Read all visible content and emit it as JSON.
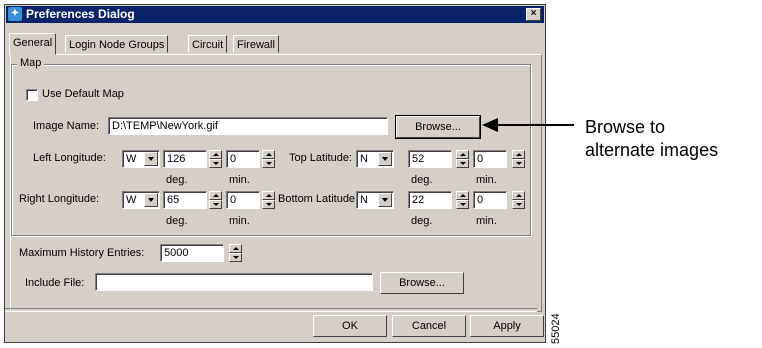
{
  "window": {
    "title": "Preferences Dialog",
    "close_glyph": "×"
  },
  "tabs": [
    {
      "label": "General",
      "active": true
    },
    {
      "label": "Login Node Groups",
      "active": false
    },
    {
      "label": "Circuit",
      "active": false
    },
    {
      "label": "Firewall",
      "active": false
    }
  ],
  "map": {
    "group_label": "Map",
    "use_default_label": "Use Default Map",
    "use_default_checked": false,
    "image_name_label": "Image Name:",
    "image_name_value": "D:\\TEMP\\NewYork.gif",
    "browse_label": "Browse...",
    "left_longitude": {
      "label": "Left Longitude:",
      "dir": "W",
      "deg": "126",
      "min": "0"
    },
    "top_latitude": {
      "label": "Top Latitude:",
      "dir": "N",
      "deg": "52",
      "min": "0"
    },
    "right_longitude": {
      "label": "Right Longitude:",
      "dir": "W",
      "deg": "65",
      "min": "0"
    },
    "bottom_latitude": {
      "label": "Bottom Latitude:",
      "dir": "N",
      "deg": "22",
      "min": "0"
    },
    "deg_label": "deg.",
    "min_label": "min."
  },
  "history": {
    "label": "Maximum History Entries:",
    "value": "5000"
  },
  "include_file": {
    "label": "Include File:",
    "value": "",
    "browse_label": "Browse..."
  },
  "footer": {
    "ok": "OK",
    "cancel": "Cancel",
    "apply": "Apply"
  },
  "callout": {
    "line1": "Browse to",
    "line2": "alternate images"
  },
  "figure_id": "55024",
  "colors": {
    "titlebar": "#0a246a",
    "dialog_bg": "#d4d0c8"
  }
}
